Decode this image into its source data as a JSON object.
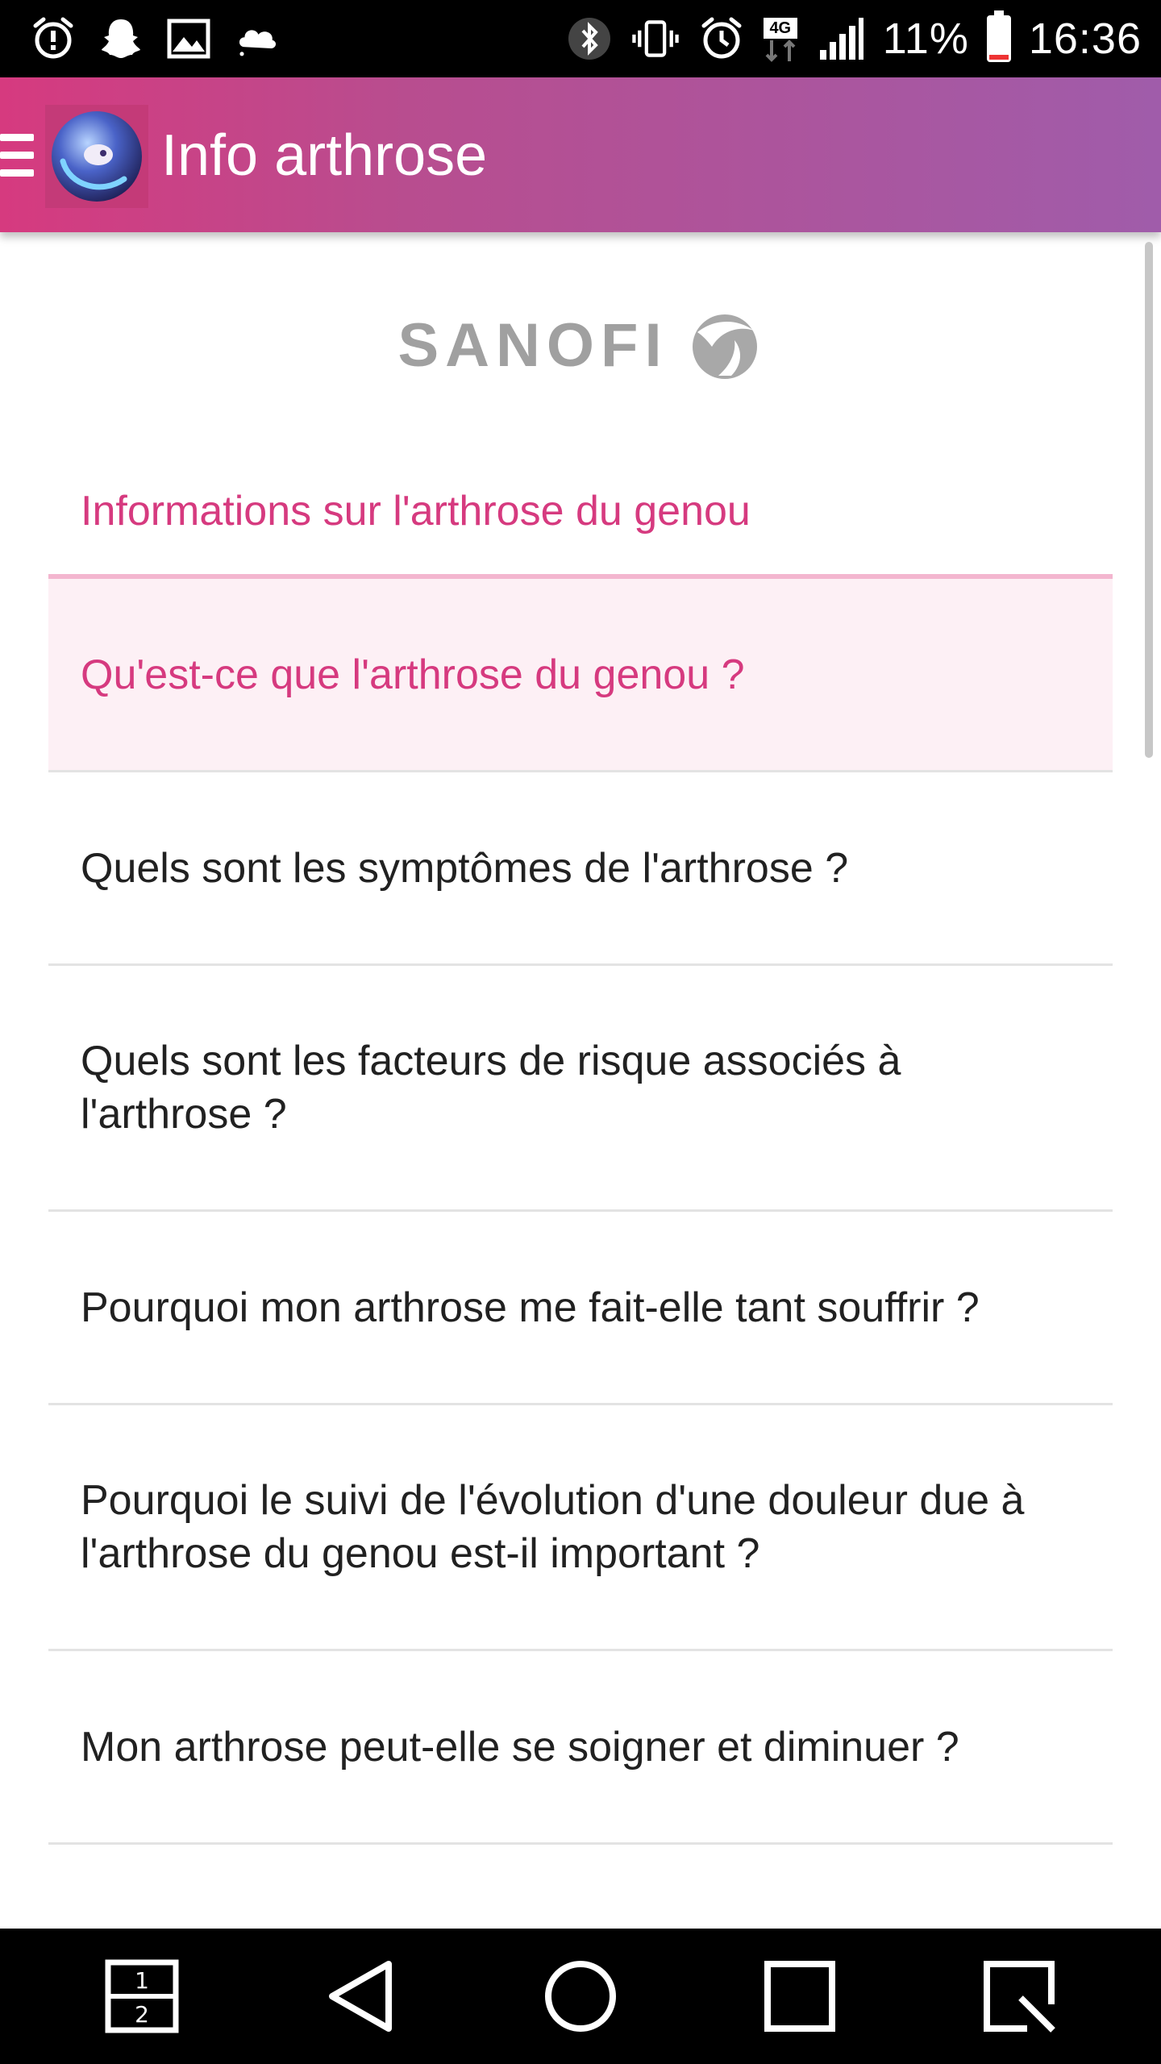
{
  "status_bar": {
    "icons_left": [
      "alarm-alert-icon",
      "snapchat-icon",
      "image-icon",
      "weather-cloud-icon"
    ],
    "icons_right": [
      "bluetooth-icon",
      "vibrate-icon",
      "alarm-icon",
      "network-4g-icon",
      "signal-icon"
    ],
    "network": "4G",
    "battery_percent": "11%",
    "battery_level": 0.11,
    "time": "16:36"
  },
  "app_bar": {
    "title": "Info arthrose"
  },
  "brand": {
    "name": "SANOFI"
  },
  "section": {
    "title": "Informations sur l'arthrose du genou"
  },
  "items": [
    {
      "label": "Qu'est-ce que l'arthrose du genou ?",
      "active": true
    },
    {
      "label": "Quels sont les symptômes de l'arthrose ?",
      "active": false
    },
    {
      "label": "Quels sont les facteurs de risque associés à l'arthrose ?",
      "active": false
    },
    {
      "label": "Pourquoi mon arthrose me fait-elle tant souffrir ?",
      "active": false
    },
    {
      "label": "Pourquoi le suivi de l'évolution d'une douleur due à l'arthrose du genou est-il important ?",
      "active": false
    },
    {
      "label": "Mon arthrose peut-elle se soigner et diminuer ?",
      "active": false
    }
  ],
  "nav_bar": {
    "buttons": [
      "dual-window-icon",
      "back-icon",
      "home-icon",
      "recents-icon",
      "capture-icon"
    ]
  },
  "colors": {
    "accent": "#d63a7f",
    "appbar_start": "#d63a7f",
    "appbar_end": "#a05caa",
    "active_item_bg": "#fdf0f5"
  }
}
